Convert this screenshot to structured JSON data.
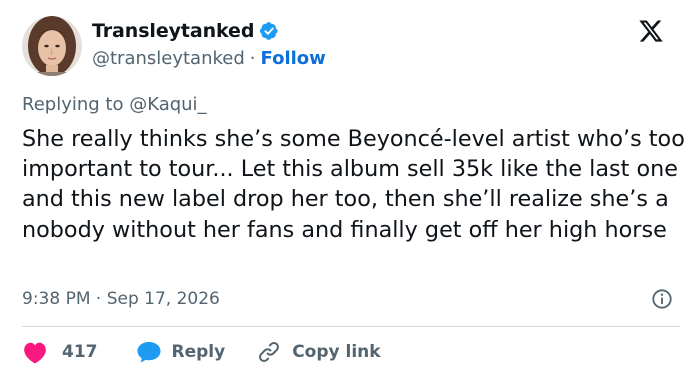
{
  "user": {
    "display_name": "Transleytanked",
    "handle": "@transleytanked",
    "separator": "·",
    "follow_label": "Follow"
  },
  "reply": {
    "prefix": "Replying to ",
    "to": "@Kaqui_"
  },
  "tweet": {
    "text": "She really thinks she’s some Beyoncé-level artist who’s too important to tour... Let this album sell 35k like the last one and this new label drop her too, then she’ll realize she’s a nobody without her fans and finally get off her high horse",
    "timestamp": "9:38 PM · Sep 17, 2026"
  },
  "actions": {
    "like_count": "417",
    "reply_label": "Reply",
    "copy_link_label": "Copy link"
  },
  "icons": {
    "verified": "verified-badge-icon",
    "platform": "x-logo-icon",
    "info": "info-icon",
    "like": "heart-icon",
    "reply": "speech-bubble-icon",
    "copy": "link-icon"
  },
  "colors": {
    "accent": "#1d9bf0",
    "follow": "#0f6fd8",
    "like": "#f91880",
    "secondary_text": "#536471",
    "primary_text": "#0f1419"
  }
}
